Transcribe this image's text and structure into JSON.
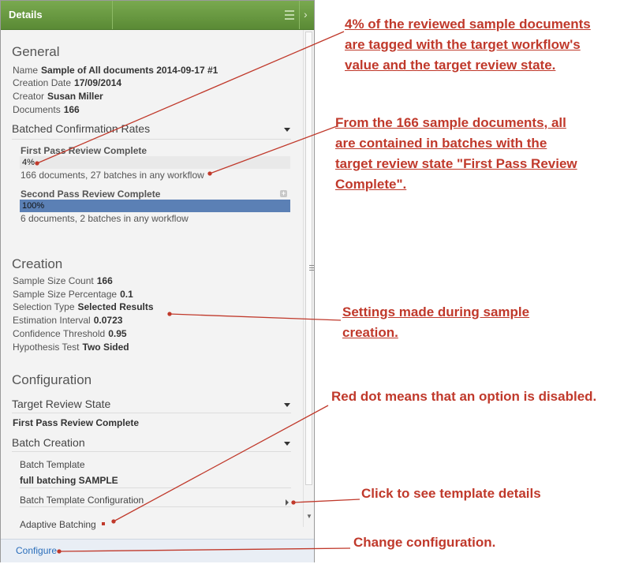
{
  "panel": {
    "title": "Details",
    "general": {
      "heading": "General",
      "props": [
        {
          "label": "Name",
          "value": "Sample of All documents 2014-09-17 #1"
        },
        {
          "label": "Creation Date",
          "value": "17/09/2014"
        },
        {
          "label": "Creator",
          "value": "Susan Miller"
        },
        {
          "label": "Documents",
          "value": "166"
        }
      ]
    },
    "rates": {
      "heading": "Batched Confirmation Rates",
      "items": [
        {
          "title": "First Pass Review Complete",
          "percent_label": "4%",
          "percent": 4,
          "note": "166 documents, 27 batches in any workflow"
        },
        {
          "title": "Second Pass Review Complete",
          "percent_label": "100%",
          "percent": 100,
          "note": "6 documents, 2 batches in any workflow"
        }
      ]
    },
    "creation": {
      "heading": "Creation",
      "props": [
        {
          "label": "Sample Size Count",
          "value": "166"
        },
        {
          "label": "Sample Size Percentage",
          "value": "0.1"
        },
        {
          "label": "Selection Type",
          "value": "Selected Results"
        },
        {
          "label": "Estimation Interval",
          "value": "0.0723"
        },
        {
          "label": "Confidence Threshold",
          "value": "0.95"
        },
        {
          "label": "Hypothesis Test",
          "value": "Two Sided"
        }
      ]
    },
    "configuration": {
      "heading": "Configuration",
      "target_state_label": "Target Review State",
      "target_state_value": "First Pass Review Complete",
      "batch_creation_label": "Batch Creation",
      "batch_template_label": "Batch Template",
      "batch_template_value": "full batching SAMPLE",
      "batch_template_config_label": "Batch Template Configuration",
      "adaptive_batching_label": "Adaptive Batching"
    },
    "footer": {
      "configure_label": "Configure"
    }
  },
  "annotations": {
    "a1": [
      "4% of the reviewed sample documents",
      "are tagged with the target workflow's",
      "value and the target review state. "
    ],
    "a2": [
      "From the 166 sample documents, all",
      "are contained in batches with the",
      "target review state \"First Pass Review",
      "Complete\".  "
    ],
    "a3": [
      "Settings made during sample",
      "creation."
    ],
    "a4": [
      "Red dot means that an option is disabled."
    ],
    "a5": [
      "Click to see template details"
    ],
    "a6": [
      "Change configuration."
    ]
  },
  "colors": {
    "accent_green": "#6a9a41",
    "bar_blue": "#5b80b5",
    "annotation_red": "#c0392b",
    "link_blue": "#2a6ebb"
  }
}
